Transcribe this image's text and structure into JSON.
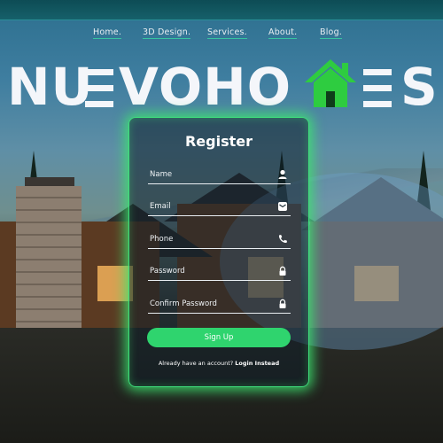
{
  "nav": {
    "items": [
      "Home.",
      "3D Design.",
      "Services.",
      "About.",
      "Blog."
    ]
  },
  "logo": {
    "text": "NUEVOHOMES",
    "icon": "house-icon",
    "accent": "#2ecc40"
  },
  "register": {
    "title": "Register",
    "fields": [
      {
        "placeholder": "Name",
        "icon": "user-icon"
      },
      {
        "placeholder": "Email",
        "icon": "email-icon"
      },
      {
        "placeholder": "Phone",
        "icon": "phone-icon"
      },
      {
        "placeholder": "Password",
        "icon": "lock-icon"
      },
      {
        "placeholder": "Confirm Password",
        "icon": "lock-icon"
      }
    ],
    "submit_label": "Sign Up",
    "login_prompt": "Already have an account?",
    "login_link": "Login Instead",
    "accent": "#2fd46e"
  }
}
